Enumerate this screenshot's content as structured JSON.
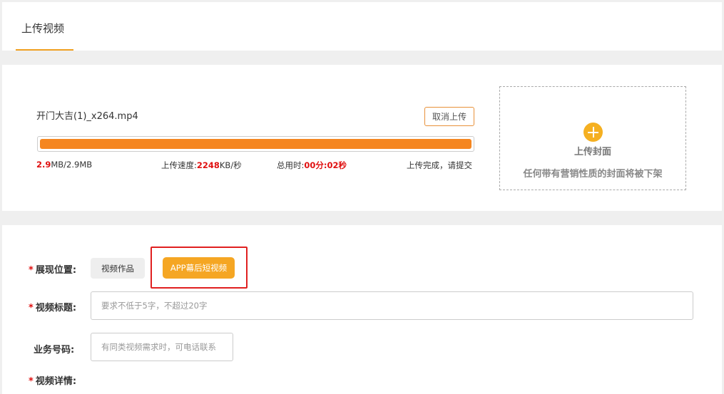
{
  "tabs": {
    "upload_video": "上传视频"
  },
  "upload": {
    "file_name": "开门大吉(1)_x264.mp4",
    "cancel_label": "取消上传",
    "progress": 1.0,
    "uploaded_size": "2.9",
    "size_rest": "MB/2.9MB",
    "speed_label": "上传速度:",
    "speed_value": "2248",
    "speed_unit": "KB/秒",
    "time_label": "总用时:",
    "time_value": "00分:02秒",
    "status": "上传完成，请提交"
  },
  "cover": {
    "icon": "plus-icon",
    "title": "上传封面",
    "note": "任何带有营销性质的封面将被下架"
  },
  "form": {
    "required_mark": "*",
    "position_label": "展现位置:",
    "position_options": [
      "视频作品",
      "APP幕后短视频"
    ],
    "selected_option": "APP幕后短视频",
    "title_label": "视频标题:",
    "title_placeholder": "要求不低于5字，不超过20字",
    "business_label": "业务号码:",
    "business_placeholder": "有同类视频需求时，可电话联系",
    "detail_label": "视频详情:"
  },
  "colors": {
    "accent": "#f5a623",
    "progress": "#f58620",
    "highlight": "#e02020",
    "required": "#e01010"
  }
}
